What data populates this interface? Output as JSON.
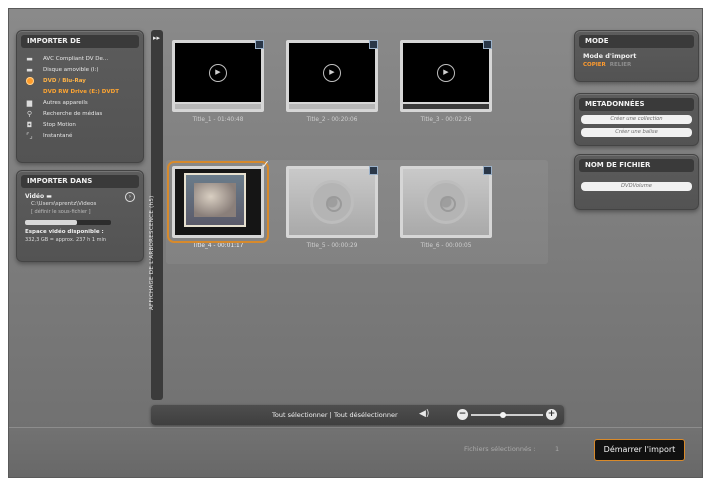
{
  "import_from": {
    "title": "IMPORTER DE",
    "sources": [
      {
        "label": "AVC Compliant DV De...",
        "icon": "folder-icon"
      },
      {
        "label": "Disque amovible (I:)",
        "icon": "removable-disk-icon"
      },
      {
        "label": "DVD / Blu-Ray",
        "icon": "disc-icon"
      },
      {
        "label": "DVD RW Drive (E:) DVDT",
        "icon": ""
      },
      {
        "label": "Autres appareils",
        "icon": "devices-icon"
      },
      {
        "label": "Recherche de médias",
        "icon": "search-icon"
      },
      {
        "label": "Stop Motion",
        "icon": "stop-motion-icon"
      },
      {
        "label": "Instantané",
        "icon": "snapshot-icon"
      }
    ]
  },
  "import_to": {
    "title": "IMPORTER DANS",
    "video_label": "Vidéo",
    "path": "C:\\Users\\sprentz\\Videos",
    "path_hint": "[ définir le sous-fichier ]",
    "space_label": "Espace vidéo disponible :",
    "space_value": "332,3 GB = approx. 237 h 1 min",
    "space_fraction": 0.6
  },
  "rail": {
    "label": "AFFICHAGE DE L'ARBORESCENCE (h5)"
  },
  "clips": [
    {
      "label": "Title_1 - 01:40:48",
      "state": "video"
    },
    {
      "label": "Title_2 - 00:20:06",
      "state": "video"
    },
    {
      "label": "Title_3 - 00:02:26",
      "state": "video"
    },
    {
      "label": "Title_4 - 00:01:17",
      "state": "selected"
    },
    {
      "label": "Title_5 - 00:00:29",
      "state": "dim"
    },
    {
      "label": "Title_6 - 00:00:05",
      "state": "dim"
    }
  ],
  "toolbar": {
    "select_all": "Tout sélectionner",
    "separator": "|",
    "deselect_all": "Tout désélectionner",
    "zoom_level": 0.45
  },
  "mode": {
    "title": "MODE",
    "import_mode_label": "Mode d'import",
    "copy_option": "COPIER",
    "other_option": "RELIER"
  },
  "metadata": {
    "title": "METADONNÉES",
    "collection_placeholder": "Créer une collection",
    "tag_placeholder": "Créer une balise"
  },
  "filename": {
    "title": "NOM DE FICHIER",
    "value": "DVDVolume"
  },
  "footer": {
    "selected_files_label": "Fichiers sélectionnés :",
    "selected_count": "1",
    "start_button": "Démarrer l'import"
  },
  "colors": {
    "accent": "#ff9b2e",
    "selection_outline": "#d78a2c"
  }
}
